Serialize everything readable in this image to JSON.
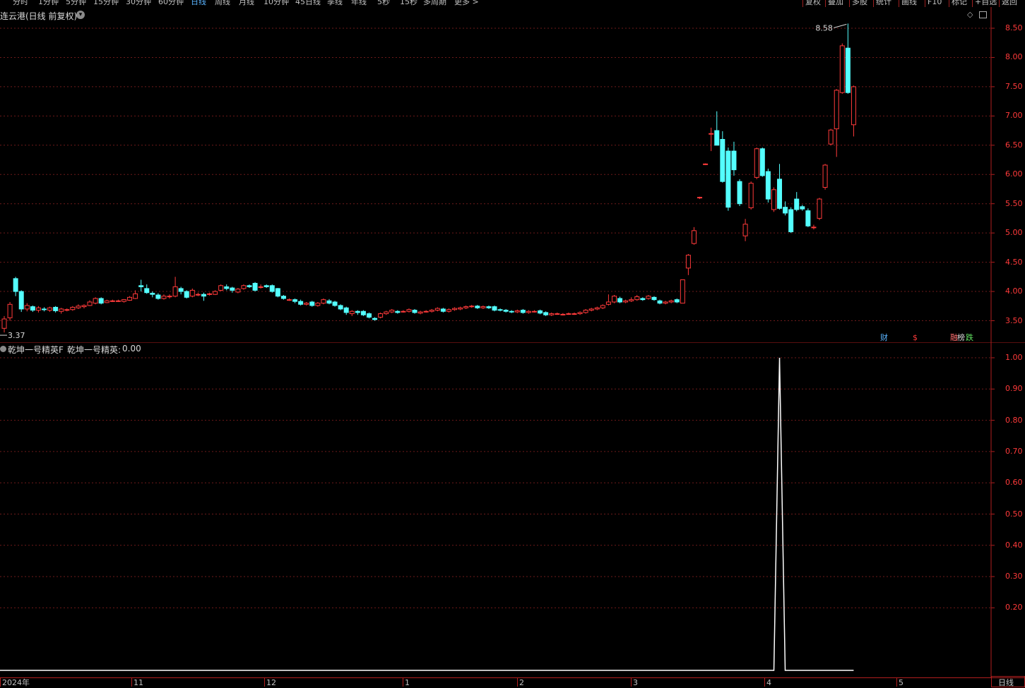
{
  "stock": {
    "title": "连云港(日线 前复权)",
    "indicator_title": "乾坤一号精英F",
    "indicator_label": "乾坤一号精英:",
    "indicator_value": "0.00"
  },
  "periods": [
    "分时",
    "1分钟",
    "5分钟",
    "15分钟",
    "30分钟",
    "60分钟",
    "日线",
    "周线",
    "月线",
    "10分钟",
    "45日线",
    "季线",
    "年线",
    "5秒",
    "15秒",
    "多周期",
    "更多 >"
  ],
  "active_period": "日线",
  "right_buttons": [
    "复权",
    "叠加",
    "多股",
    "统计",
    "画线",
    "F10",
    "标记",
    "+自选",
    "返回"
  ],
  "price_axis": [
    "8.50",
    "8.00",
    "7.50",
    "7.00",
    "6.50",
    "6.00",
    "5.50",
    "5.00",
    "4.50",
    "4.00",
    "3.50"
  ],
  "indicator_axis": [
    "1.00",
    "0.90",
    "0.80",
    "0.70",
    "0.60",
    "0.50",
    "0.40",
    "0.30",
    "0.20"
  ],
  "date_labels": [
    "2024年",
    "11",
    "12",
    "1",
    "2",
    "3",
    "4",
    "5"
  ],
  "period_corner": "日线",
  "max_label": "8.58",
  "min_label": "3.37",
  "badges": [
    {
      "text": "财",
      "color": "#5ab4ff"
    },
    {
      "text": "$",
      "color": "#ff3a3a"
    },
    {
      "text": "融",
      "color": "#ff7070"
    },
    {
      "text": "榜",
      "color": "#d8d8d8"
    },
    {
      "text": "跌",
      "color": "#60e060"
    }
  ],
  "colors": {
    "up": "#ff3a3a",
    "down": "#54ffff",
    "grid": "#6e1a1a",
    "border": "#b01e1e",
    "axis_text": "#ff3a3a",
    "indicator_line": "#ffffff"
  },
  "chart_data": {
    "type": "candlestick",
    "price_range": [
      3.37,
      8.58
    ],
    "candles": [
      [
        3.37,
        3.53,
        3.3,
        3.58
      ],
      [
        3.55,
        3.78,
        3.5,
        3.82
      ],
      [
        4.22,
        4.0,
        3.92,
        4.25
      ],
      [
        4.0,
        3.7,
        3.65,
        4.02
      ],
      [
        3.7,
        3.76,
        3.66,
        3.8
      ],
      [
        3.74,
        3.68,
        3.65,
        3.76
      ],
      [
        3.68,
        3.72,
        3.64,
        3.75
      ],
      [
        3.7,
        3.69,
        3.66,
        3.73
      ],
      [
        3.68,
        3.72,
        3.65,
        3.74
      ],
      [
        3.73,
        3.67,
        3.64,
        3.75
      ],
      [
        3.66,
        3.7,
        3.62,
        3.72
      ],
      [
        3.68,
        3.69,
        3.66,
        3.71
      ],
      [
        3.69,
        3.73,
        3.67,
        3.75
      ],
      [
        3.72,
        3.75,
        3.7,
        3.78
      ],
      [
        3.74,
        3.76,
        3.71,
        3.78
      ],
      [
        3.76,
        3.82,
        3.75,
        3.85
      ],
      [
        3.8,
        3.88,
        3.78,
        3.9
      ],
      [
        3.88,
        3.8,
        3.78,
        3.9
      ],
      [
        3.81,
        3.84,
        3.8,
        3.86
      ],
      [
        3.84,
        3.84,
        3.82,
        3.86
      ],
      [
        3.84,
        3.84,
        3.82,
        3.86
      ],
      [
        3.83,
        3.86,
        3.81,
        3.87
      ],
      [
        3.85,
        3.9,
        3.84,
        3.92
      ],
      [
        3.88,
        3.96,
        3.87,
        4.02
      ],
      [
        4.1,
        4.08,
        4.0,
        4.2
      ],
      [
        4.05,
        3.98,
        3.96,
        4.12
      ],
      [
        3.97,
        3.95,
        3.9,
        4.0
      ],
      [
        3.94,
        3.88,
        3.86,
        3.97
      ],
      [
        3.88,
        3.92,
        3.86,
        3.95
      ],
      [
        3.91,
        3.92,
        3.88,
        3.95
      ],
      [
        3.92,
        4.08,
        3.9,
        4.25
      ],
      [
        4.05,
        4.0,
        3.95,
        4.08
      ],
      [
        4.0,
        3.9,
        3.88,
        4.02
      ],
      [
        3.92,
        4.02,
        3.9,
        4.05
      ],
      [
        3.95,
        3.95,
        3.92,
        3.98
      ],
      [
        3.95,
        3.92,
        3.84,
        3.98
      ],
      [
        3.95,
        3.96,
        3.93,
        3.98
      ],
      [
        3.95,
        4.0,
        3.94,
        4.02
      ],
      [
        4.02,
        4.1,
        4.0,
        4.12
      ],
      [
        4.08,
        4.05,
        4.02,
        4.12
      ],
      [
        4.06,
        4.02,
        3.98,
        4.08
      ],
      [
        3.99,
        4.04,
        3.97,
        4.06
      ],
      [
        4.05,
        4.1,
        4.03,
        4.12
      ],
      [
        4.1,
        4.08,
        4.06,
        4.12
      ],
      [
        4.14,
        4.02,
        4.0,
        4.16
      ],
      [
        4.08,
        4.08,
        4.05,
        4.12
      ],
      [
        4.1,
        4.08,
        4.06,
        4.12
      ],
      [
        4.1,
        4.0,
        3.98,
        4.12
      ],
      [
        4.05,
        3.92,
        3.9,
        4.06
      ],
      [
        3.92,
        3.88,
        3.86,
        3.94
      ],
      [
        3.86,
        3.86,
        3.84,
        3.88
      ],
      [
        3.86,
        3.83,
        3.8,
        3.88
      ],
      [
        3.83,
        3.78,
        3.76,
        3.86
      ],
      [
        3.78,
        3.8,
        3.76,
        3.82
      ],
      [
        3.82,
        3.76,
        3.74,
        3.84
      ],
      [
        3.76,
        3.8,
        3.74,
        3.82
      ],
      [
        3.8,
        3.86,
        3.78,
        3.88
      ],
      [
        3.84,
        3.8,
        3.78,
        3.87
      ],
      [
        3.82,
        3.76,
        3.74,
        3.84
      ],
      [
        3.76,
        3.7,
        3.68,
        3.78
      ],
      [
        3.72,
        3.64,
        3.6,
        3.74
      ],
      [
        3.62,
        3.66,
        3.58,
        3.68
      ],
      [
        3.66,
        3.64,
        3.6,
        3.68
      ],
      [
        3.66,
        3.6,
        3.58,
        3.68
      ],
      [
        3.62,
        3.56,
        3.54,
        3.64
      ],
      [
        3.54,
        3.52,
        3.5,
        3.56
      ],
      [
        3.56,
        3.62,
        3.54,
        3.64
      ],
      [
        3.62,
        3.65,
        3.6,
        3.67
      ],
      [
        3.65,
        3.68,
        3.63,
        3.7
      ],
      [
        3.66,
        3.64,
        3.62,
        3.68
      ],
      [
        3.66,
        3.66,
        3.64,
        3.68
      ],
      [
        3.66,
        3.69,
        3.64,
        3.71
      ],
      [
        3.68,
        3.64,
        3.62,
        3.7
      ],
      [
        3.63,
        3.65,
        3.61,
        3.67
      ],
      [
        3.66,
        3.66,
        3.64,
        3.68
      ],
      [
        3.66,
        3.68,
        3.64,
        3.7
      ],
      [
        3.68,
        3.71,
        3.66,
        3.73
      ],
      [
        3.7,
        3.66,
        3.64,
        3.72
      ],
      [
        3.66,
        3.69,
        3.64,
        3.71
      ],
      [
        3.69,
        3.71,
        3.67,
        3.73
      ],
      [
        3.7,
        3.72,
        3.68,
        3.74
      ],
      [
        3.72,
        3.74,
        3.7,
        3.76
      ],
      [
        3.74,
        3.75,
        3.72,
        3.77
      ],
      [
        3.75,
        3.72,
        3.7,
        3.77
      ],
      [
        3.72,
        3.74,
        3.7,
        3.76
      ],
      [
        3.74,
        3.72,
        3.7,
        3.76
      ],
      [
        3.74,
        3.68,
        3.66,
        3.76
      ],
      [
        3.69,
        3.68,
        3.66,
        3.71
      ],
      [
        3.68,
        3.66,
        3.64,
        3.7
      ],
      [
        3.66,
        3.65,
        3.63,
        3.68
      ],
      [
        3.65,
        3.67,
        3.63,
        3.69
      ],
      [
        3.68,
        3.64,
        3.62,
        3.7
      ],
      [
        3.64,
        3.66,
        3.62,
        3.68
      ],
      [
        3.66,
        3.66,
        3.64,
        3.68
      ],
      [
        3.67,
        3.63,
        3.61,
        3.69
      ],
      [
        3.64,
        3.6,
        3.58,
        3.66
      ],
      [
        3.6,
        3.62,
        3.58,
        3.64
      ],
      [
        3.62,
        3.62,
        3.6,
        3.64
      ],
      [
        3.61,
        3.61,
        3.59,
        3.63
      ],
      [
        3.62,
        3.62,
        3.6,
        3.64
      ],
      [
        3.62,
        3.62,
        3.6,
        3.64
      ],
      [
        3.62,
        3.64,
        3.6,
        3.66
      ],
      [
        3.64,
        3.68,
        3.62,
        3.7
      ],
      [
        3.68,
        3.7,
        3.66,
        3.72
      ],
      [
        3.7,
        3.72,
        3.68,
        3.74
      ],
      [
        3.72,
        3.76,
        3.7,
        3.78
      ],
      [
        3.78,
        3.82,
        3.76,
        3.95
      ],
      [
        3.82,
        3.92,
        3.8,
        3.94
      ],
      [
        3.88,
        3.82,
        3.8,
        3.91
      ],
      [
        3.82,
        3.84,
        3.8,
        3.86
      ],
      [
        3.84,
        3.86,
        3.82,
        3.9
      ],
      [
        3.86,
        3.91,
        3.84,
        3.94
      ],
      [
        3.88,
        3.86,
        3.84,
        3.9
      ],
      [
        3.88,
        3.92,
        3.86,
        3.94
      ],
      [
        3.9,
        3.86,
        3.84,
        3.92
      ],
      [
        3.84,
        3.8,
        3.78,
        3.86
      ],
      [
        3.8,
        3.82,
        3.78,
        3.84
      ],
      [
        3.82,
        3.84,
        3.8,
        3.86
      ],
      [
        3.86,
        3.82,
        3.8,
        3.88
      ],
      [
        3.8,
        4.2,
        3.8,
        4.2
      ],
      [
        4.4,
        4.62,
        4.28,
        4.64
      ],
      [
        4.82,
        5.04,
        4.8,
        5.1
      ],
      [
        5.6,
        5.61,
        5.58,
        5.62
      ],
      [
        6.18,
        6.18,
        6.16,
        6.19
      ],
      [
        6.7,
        6.7,
        6.4,
        6.8
      ],
      [
        6.75,
        6.5,
        6.5,
        7.08
      ],
      [
        6.6,
        5.88,
        5.86,
        6.74
      ],
      [
        6.4,
        5.44,
        5.38,
        6.46
      ],
      [
        6.4,
        6.08,
        5.98,
        6.56
      ],
      [
        5.88,
        5.5,
        5.46,
        5.92
      ],
      [
        4.95,
        5.15,
        4.86,
        5.24
      ],
      [
        5.43,
        5.85,
        5.4,
        5.88
      ],
      [
        5.95,
        6.44,
        5.92,
        6.46
      ],
      [
        6.44,
        5.98,
        5.96,
        6.46
      ],
      [
        6.05,
        5.58,
        5.52,
        6.1
      ],
      [
        5.4,
        5.74,
        5.36,
        5.78
      ],
      [
        5.92,
        5.42,
        5.4,
        6.18
      ],
      [
        5.44,
        5.34,
        5.3,
        5.54
      ],
      [
        5.4,
        5.02,
        5.0,
        5.44
      ],
      [
        5.58,
        5.4,
        5.37,
        5.7
      ],
      [
        5.45,
        5.41,
        5.38,
        5.48
      ],
      [
        5.38,
        5.12,
        5.1,
        5.42
      ],
      [
        5.1,
        5.1,
        5.06,
        5.14
      ],
      [
        5.25,
        5.58,
        5.22,
        5.6
      ],
      [
        5.78,
        6.16,
        5.74,
        6.18
      ],
      [
        6.52,
        6.76,
        6.5,
        6.78
      ],
      [
        6.78,
        7.44,
        6.3,
        7.46
      ],
      [
        7.4,
        8.2,
        7.38,
        8.24
      ],
      [
        8.16,
        7.4,
        7.38,
        8.58
      ],
      [
        6.85,
        7.5,
        6.65,
        7.52
      ]
    ],
    "indicator": {
      "name": "乾坤一号精英",
      "range": [
        0,
        1
      ],
      "spike_index": 136,
      "spike_value": 1.0,
      "baseline": 0.0
    }
  }
}
